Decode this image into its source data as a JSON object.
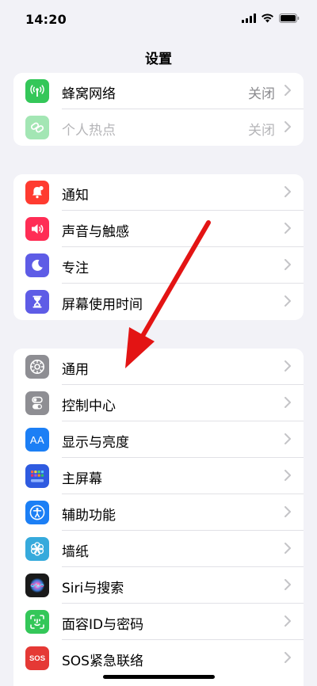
{
  "status_bar": {
    "time": "14:20"
  },
  "nav": {
    "title": "设置"
  },
  "groups": [
    {
      "items": [
        {
          "label": "蜂窝网络",
          "value": "关闭",
          "icon": "cellular-antenna-icon",
          "color": "#34c759"
        },
        {
          "label": "个人热点",
          "value": "关闭",
          "icon": "hotspot-chain-icon",
          "color": "#34c759",
          "disabled": true
        }
      ]
    },
    {
      "items": [
        {
          "label": "通知",
          "icon": "bell-icon",
          "color": "#ff3b30"
        },
        {
          "label": "声音与触感",
          "icon": "speaker-icon",
          "color": "#ff2d55"
        },
        {
          "label": "专注",
          "icon": "moon-icon",
          "color": "#5e5ce6"
        },
        {
          "label": "屏幕使用时间",
          "icon": "hourglass-icon",
          "color": "#5e5ce6"
        }
      ]
    },
    {
      "items": [
        {
          "label": "通用",
          "icon": "gear-icon",
          "color": "#8e8e93"
        },
        {
          "label": "控制中心",
          "icon": "toggles-icon",
          "color": "#8e8e93"
        },
        {
          "label": "显示与亮度",
          "icon": "text-size-icon",
          "color": "#1c7ff5"
        },
        {
          "label": "主屏幕",
          "icon": "home-grid-icon",
          "color": "#2f5be0"
        },
        {
          "label": "辅助功能",
          "icon": "accessibility-icon",
          "color": "#1c7ff5"
        },
        {
          "label": "墙纸",
          "icon": "flower-icon",
          "color": "#36aadc"
        },
        {
          "label": "Siri与搜索",
          "icon": "siri-icon",
          "color": "#1a1a1a"
        },
        {
          "label": "面容ID与密码",
          "icon": "face-id-icon",
          "color": "#34c759"
        },
        {
          "label": "SOS紧急联络",
          "icon": "sos-icon",
          "color": "#e53935"
        }
      ]
    }
  ],
  "icons": {
    "aa_text": "AA",
    "sos_text": "SOS"
  },
  "annotation": {
    "color": "#e31414"
  }
}
